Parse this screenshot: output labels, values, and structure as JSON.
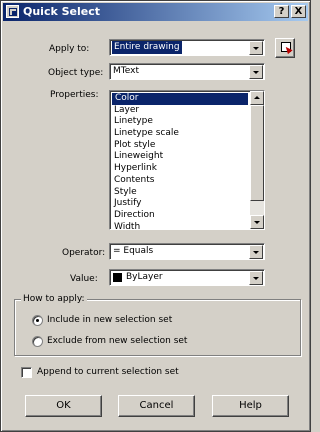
{
  "window": {
    "title": "Quick Select"
  },
  "titlebar_buttons": {
    "help": "?",
    "close": "X"
  },
  "apply_to": {
    "label": "Apply to:",
    "value": "Entire drawing"
  },
  "object_type": {
    "label": "Object type:",
    "value": "MText"
  },
  "properties": {
    "label": "Properties:",
    "items": [
      "Color",
      "Layer",
      "Linetype",
      "Linetype scale",
      "Plot style",
      "Lineweight",
      "Hyperlink",
      "Contents",
      "Style",
      "Justify",
      "Direction",
      "Width"
    ],
    "selected": "Color"
  },
  "operator": {
    "label": "Operator:",
    "value": "= Equals"
  },
  "value": {
    "label": "Value:",
    "value": "ByLayer",
    "swatch_color": "#000000"
  },
  "how_to_apply": {
    "title": "How to apply:",
    "include_label": "Include in new selection set",
    "exclude_label": "Exclude from new selection set",
    "selected": "include"
  },
  "append": {
    "label": "Append to current selection set",
    "checked": false
  },
  "buttons": {
    "ok": "OK",
    "cancel": "Cancel",
    "help": "Help"
  }
}
